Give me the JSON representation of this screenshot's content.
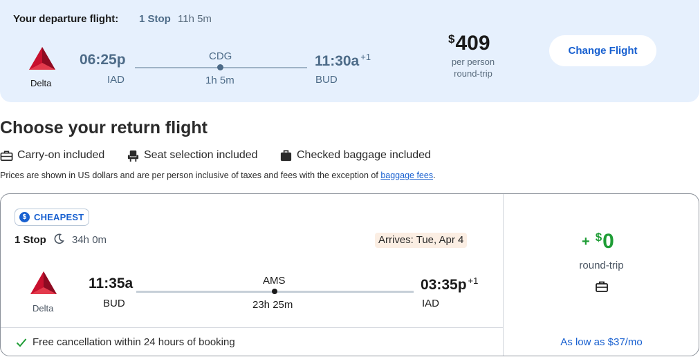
{
  "departure": {
    "header_label": "Your departure flight:",
    "stops": "1 Stop",
    "duration": "11h 5m",
    "airline": "Delta",
    "depart_time": "06:25p",
    "origin": "IAD",
    "layover": "CDG",
    "travel_time": "1h 5m",
    "arrive_time": "11:30a",
    "arrive_day_offset": "+1",
    "destination": "BUD",
    "price_currency": "$",
    "price": "409",
    "price_note_1": "per person",
    "price_note_2": "round-trip",
    "change_button": "Change Flight"
  },
  "return_section": {
    "title": "Choose your return flight",
    "amenities": {
      "carry_on": "Carry-on included",
      "seat": "Seat selection included",
      "checked": "Checked baggage included"
    },
    "disclaimer": "Prices are shown in US dollars and are per person inclusive of taxes and fees with the exception of",
    "disclaimer_link": "baggage fees",
    "disclaimer_end": "."
  },
  "return_flight": {
    "badge": "CHEAPEST",
    "stops": "1 Stop",
    "duration": "34h 0m",
    "arrives": "Arrives: Tue, Apr 4",
    "airline": "Delta",
    "depart_time": "11:35a",
    "origin": "BUD",
    "layover": "AMS",
    "travel_time": "23h 25m",
    "arrive_time": "03:35p",
    "arrive_day_offset": "+1",
    "destination": "IAD",
    "free_cancel": "Free cancellation within 24 hours of booking",
    "add_sign": "+",
    "add_currency": "$",
    "add_price": "0",
    "price_note": "round-trip",
    "financing": "As low as $37/mo"
  },
  "colors": {
    "delta_red": "#c8102e",
    "link_blue": "#1860d0",
    "price_green": "#1f9d36",
    "departure_bg": "#e6f0fd"
  },
  "icons": [
    "delta-logo",
    "suitcase-icon",
    "seat-icon",
    "checked-bag-icon",
    "dollar-badge-icon",
    "moon-icon",
    "check-icon",
    "briefcase-icon"
  ]
}
